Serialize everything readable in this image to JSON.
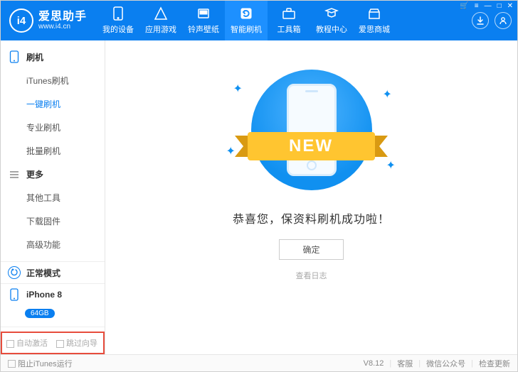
{
  "app": {
    "logo_letters": "i4",
    "logo_cn": "爱思助手",
    "logo_url": "www.i4.cn"
  },
  "nav": [
    {
      "label": "我的设备"
    },
    {
      "label": "应用游戏"
    },
    {
      "label": "铃声壁纸"
    },
    {
      "label": "智能刷机"
    },
    {
      "label": "工具箱"
    },
    {
      "label": "教程中心"
    },
    {
      "label": "爱思商城"
    }
  ],
  "sidebar": {
    "group1": {
      "title": "刷机",
      "items": [
        "iTunes刷机",
        "一键刷机",
        "专业刷机",
        "批量刷机"
      ]
    },
    "group2": {
      "title": "更多",
      "items": [
        "其他工具",
        "下载固件",
        "高级功能"
      ]
    },
    "mode": "正常模式",
    "device": {
      "name": "iPhone 8",
      "storage": "64GB"
    },
    "chk_auto": "自动激活",
    "chk_skip": "跳过向导"
  },
  "main": {
    "ribbon": "NEW",
    "success": "恭喜您，保资料刷机成功啦！",
    "ok": "确定",
    "log": "查看日志"
  },
  "status": {
    "block_itunes": "阻止iTunes运行",
    "version": "V8.12",
    "svc": "客服",
    "wechat": "微信公众号",
    "update": "检查更新"
  }
}
